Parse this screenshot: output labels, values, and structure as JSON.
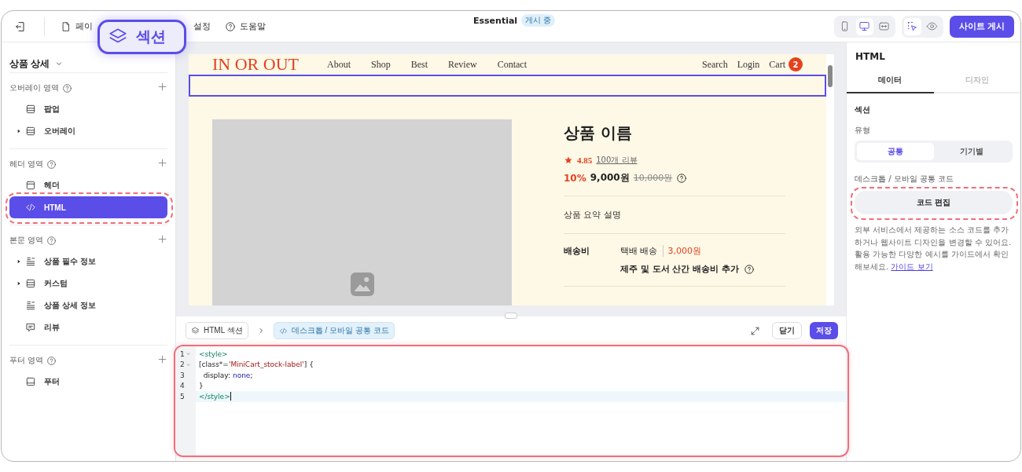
{
  "top_bar": {
    "menu": [
      {
        "kind": "page",
        "label": "페이"
      },
      {
        "kind": "plain",
        "label": "설정"
      },
      {
        "kind": "help",
        "label": "도움말"
      }
    ],
    "site_title": "Essential",
    "status_badge": "게시 중",
    "devices": [
      {
        "kind": "mobile",
        "selected": false
      },
      {
        "kind": "desktop",
        "selected": true
      },
      {
        "kind": "responsive",
        "selected": false
      }
    ],
    "tools": [
      {
        "kind": "select",
        "selected": true
      },
      {
        "kind": "preview",
        "selected": false
      }
    ],
    "publish_button": "사이트 게시"
  },
  "callout": {
    "label": "섹션"
  },
  "sidebar": {
    "page_select": "상품 상세",
    "groups": [
      {
        "title": "오버레이 영역",
        "items": [
          {
            "kind": "section",
            "label": "팝업",
            "expandable": false,
            "selected": false
          },
          {
            "kind": "section",
            "label": "오버레이",
            "expandable": true,
            "selected": false
          }
        ]
      },
      {
        "title": "헤더 영역",
        "items": [
          {
            "kind": "header",
            "label": "헤더",
            "expandable": false,
            "selected": false
          },
          {
            "kind": "html",
            "label": "HTML",
            "expandable": false,
            "selected": true,
            "highlighted": true
          }
        ]
      },
      {
        "title": "본문 영역",
        "items": [
          {
            "kind": "list",
            "label": "상품 필수 정보",
            "expandable": true,
            "selected": false
          },
          {
            "kind": "section",
            "label": "커스텀",
            "expandable": true,
            "selected": false
          },
          {
            "kind": "list",
            "label": "상품 상세 정보",
            "expandable": false,
            "selected": false
          },
          {
            "kind": "review",
            "label": "리뷰",
            "expandable": false,
            "selected": false
          }
        ]
      },
      {
        "title": "푸터 영역",
        "items": [
          {
            "kind": "footer",
            "label": "푸터",
            "expandable": false,
            "selected": false
          }
        ]
      }
    ]
  },
  "preview": {
    "logo": "IN OR OUT",
    "nav": [
      "About",
      "Shop",
      "Best",
      "Review",
      "Contact"
    ],
    "right_nav": [
      "Search",
      "Login",
      "Cart"
    ],
    "cart_count": "2",
    "product": {
      "name": "상품 이름",
      "rating": "4.85",
      "reviews": "100개 리뷰",
      "discount": "10%",
      "price": "9,000원",
      "original_price": "10,000원",
      "summary": "상품 요약 설명",
      "shipping_label": "배송비",
      "shipping_method": "택배 배송",
      "shipping_fee": "3,000원",
      "shipping_note": "제주 및 도서 산간 배송비 추가"
    }
  },
  "editor": {
    "breadcrumb": [
      {
        "label": "HTML 섹션",
        "active": false
      },
      {
        "label": "데스크톱 / 모바일 공통 코드",
        "active": true
      }
    ],
    "close_button": "닫기",
    "save_button": "저장",
    "lines": [
      {
        "number": "1",
        "fold": true,
        "active": false,
        "tokens": [
          {
            "kind": "tag",
            "text": "<style>"
          }
        ]
      },
      {
        "number": "2",
        "fold": true,
        "active": false,
        "tokens": [
          {
            "kind": "plain",
            "text": "[class*="
          },
          {
            "kind": "string",
            "text": "'MiniCart_stock-label'"
          },
          {
            "kind": "plain",
            "text": "] {"
          }
        ]
      },
      {
        "number": "3",
        "fold": false,
        "active": false,
        "tokens": [
          {
            "kind": "plain",
            "text": "  display: "
          },
          {
            "kind": "keyword",
            "text": "none"
          },
          {
            "kind": "plain",
            "text": ";"
          }
        ]
      },
      {
        "number": "4",
        "fold": false,
        "active": false,
        "tokens": [
          {
            "kind": "plain",
            "text": "}"
          }
        ]
      },
      {
        "number": "5",
        "fold": false,
        "active": true,
        "tokens": [
          {
            "kind": "tag",
            "text": "</style>"
          }
        ]
      }
    ]
  },
  "panel": {
    "title": "HTML",
    "tabs": [
      {
        "label": "데이터",
        "selected": true
      },
      {
        "label": "디자인",
        "selected": false
      }
    ],
    "section_heading": "섹션",
    "type_label": "유형",
    "type_options": [
      {
        "label": "공통",
        "selected": true
      },
      {
        "label": "기기별",
        "selected": false
      }
    ],
    "code_label": "데스크톱 / 모바일 공통 코드",
    "edit_button": "코드 편집",
    "edit_highlighted": true,
    "description": "외부 서비스에서 제공하는 소스 코드를 추가하거나 웹사이트 디자인을 변경할 수 있어요. 활용 가능한 다양한 예시를 가이드에서 확인해보세요.",
    "guide_link": "가이드 보기"
  }
}
